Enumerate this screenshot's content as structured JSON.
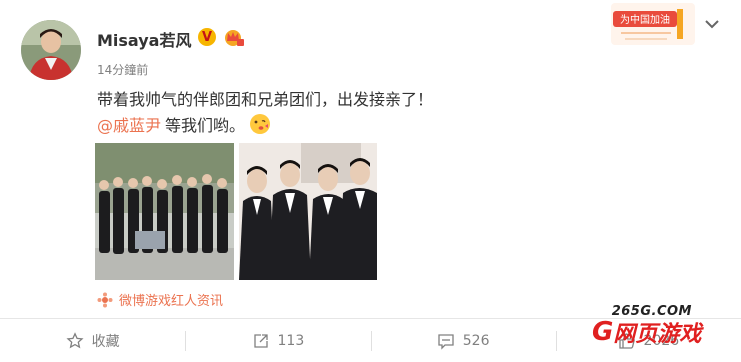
{
  "post": {
    "username": "Misaya若风",
    "timestamp": "14分鐘前",
    "text_line1": "带着我帅气的伴郎团和兄弟团们，出发接亲了！",
    "mention": "@戚蓝尹",
    "text_line2": "等我们哟。",
    "source": "微博游戏红人资讯",
    "verified_badge": "V",
    "icons": {
      "verified": "verified-v-badge-icon",
      "member": "crown-member-icon",
      "emoji": "kiss-face-emoji-icon",
      "source": "weibo-logo-icon",
      "more": "chevron-down-icon"
    }
  },
  "actions": {
    "favorite_label": "收藏",
    "repost_count": "113",
    "comment_count": "526",
    "like_count": "2026"
  },
  "event_badge": {
    "text": "为中国加油"
  },
  "watermark": {
    "domain": "265G.COM",
    "g": "G",
    "name": "网页游戏"
  },
  "colors": {
    "text": "#333333",
    "muted": "#808080",
    "link": "#eb7350",
    "watermark": "#e02020"
  }
}
